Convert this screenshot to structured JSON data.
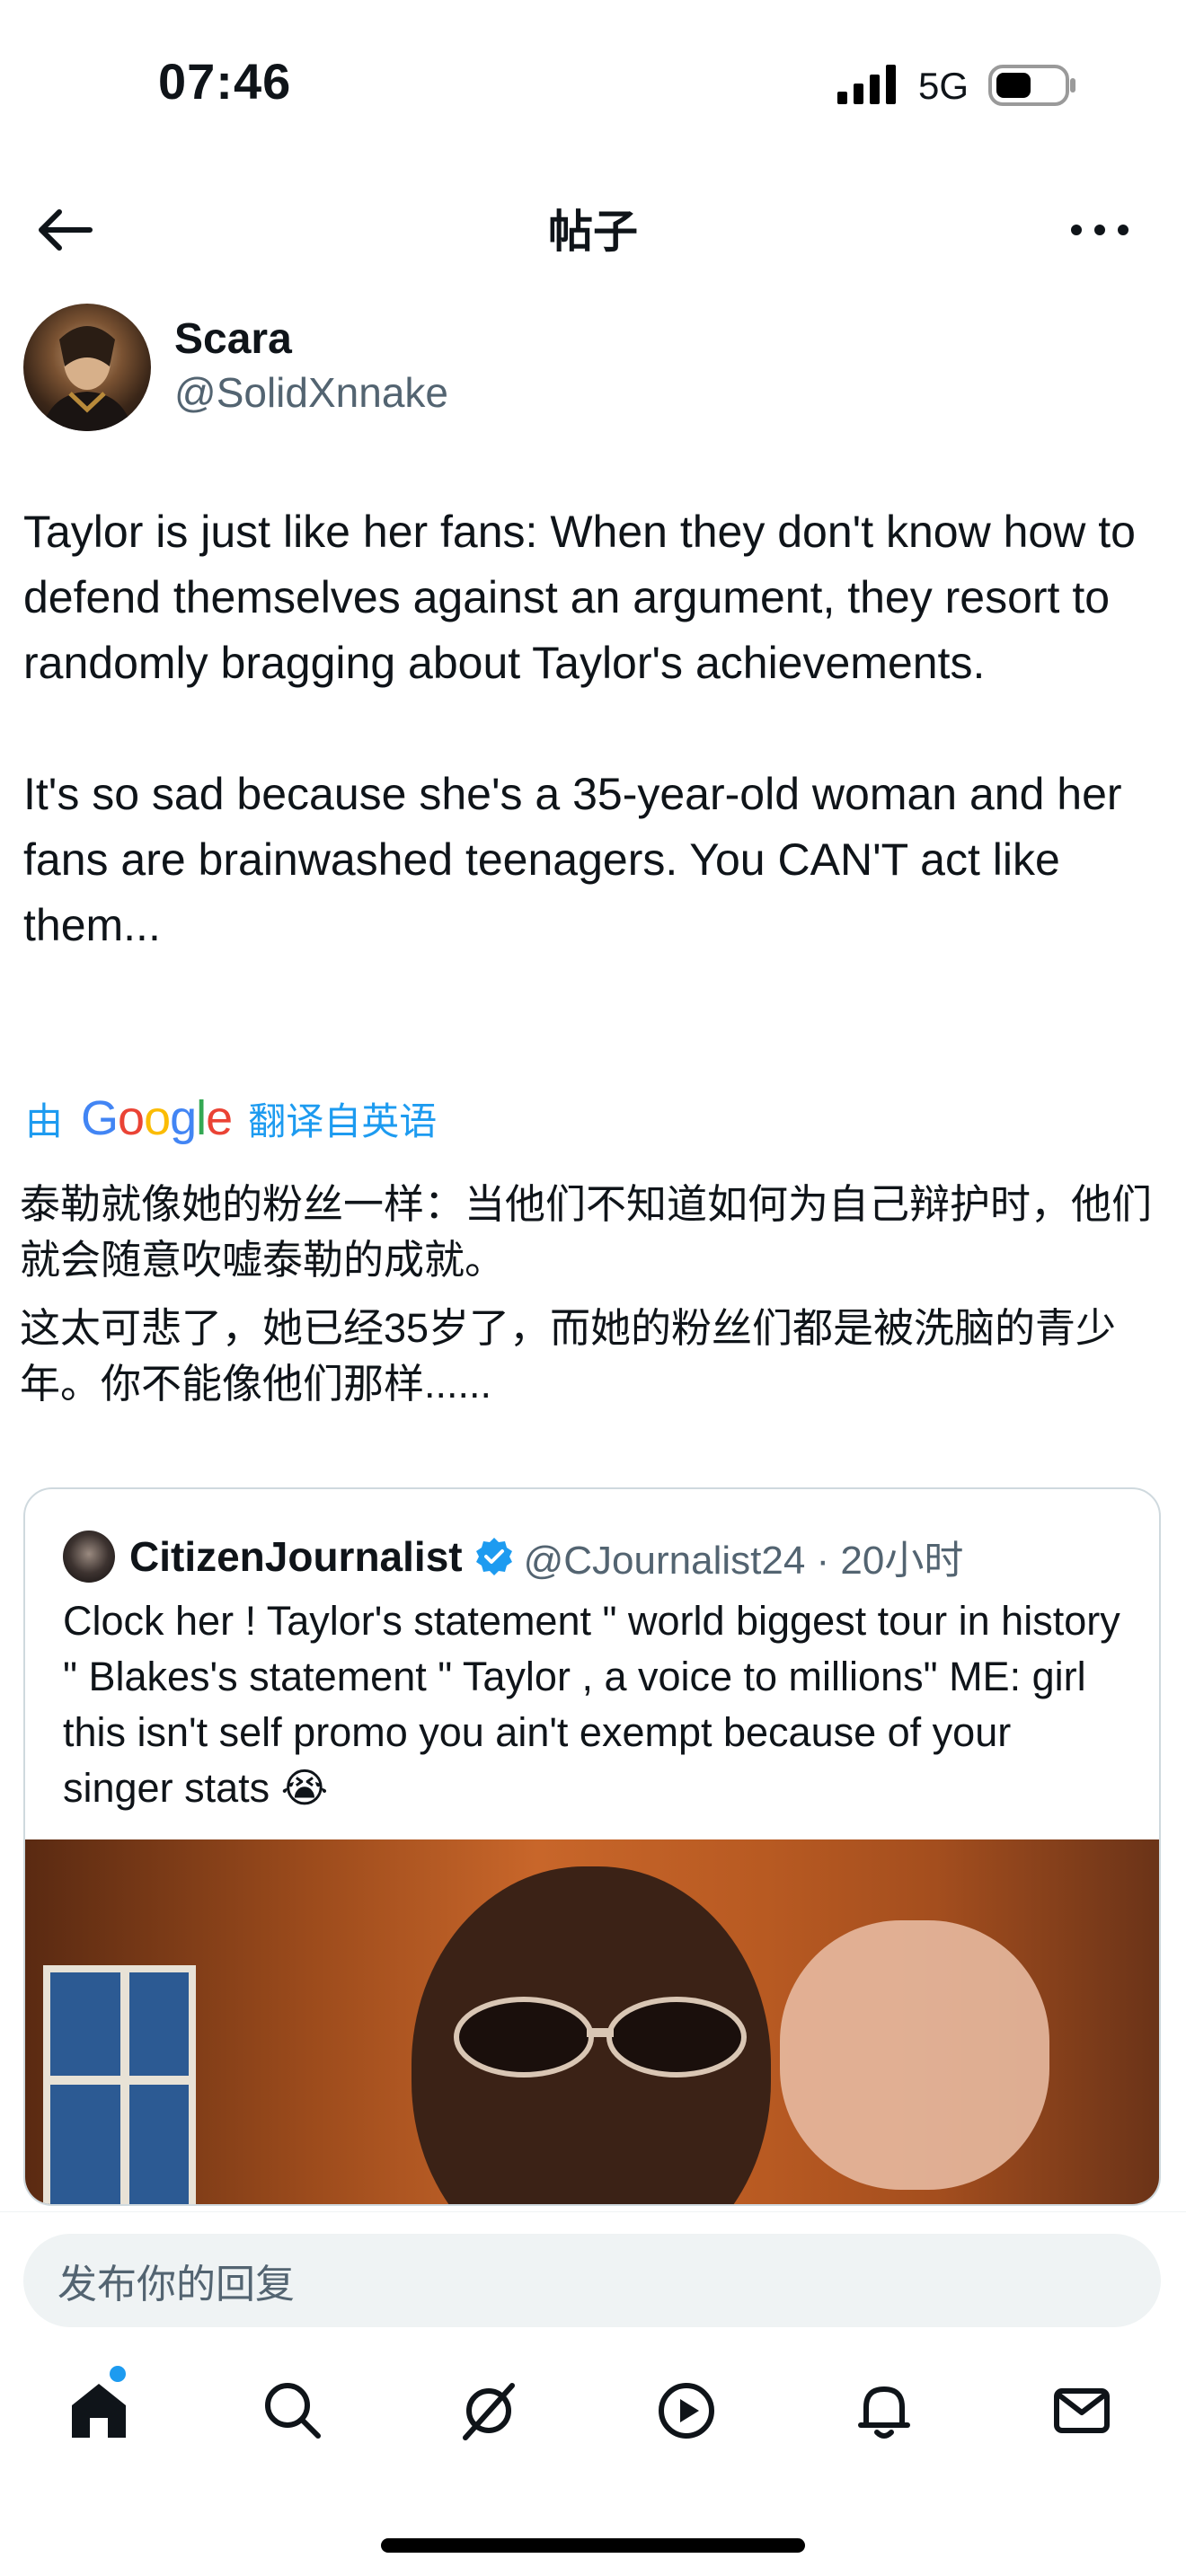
{
  "status_bar": {
    "time": "07:46",
    "network": "5G",
    "signal_icon": "signal-bars-icon",
    "battery_icon": "battery-icon"
  },
  "header": {
    "title": "帖子",
    "back_icon": "back-arrow-icon",
    "more_icon": "more-options-icon"
  },
  "post": {
    "author_name": "Scara",
    "author_handle": "@SolidXnnake",
    "paragraphs": [
      "Taylor is just like her fans: When they don't know how to defend themselves against an argument, they resort to randomly bragging about Taylor's achievements.",
      "It's so sad because she's a 35-year-old woman and her fans are brainwashed teenagers. You CAN'T act like them..."
    ],
    "translate_prefix": "由",
    "translate_brand": "Google",
    "translate_suffix": "翻译自英语",
    "translated_paragraphs": [
      "泰勒就像她的粉丝一样：当他们不知道如何为自己辩护时，他们就会随意吹嘘泰勒的成就。",
      "这太可悲了，她已经35岁了，而她的粉丝们都是被洗脑的青少年。你不能像他们那样......"
    ]
  },
  "quote": {
    "name": "CitizenJournalist",
    "verified_icon": "verified-badge-icon",
    "handle_time": "@CJournalist24 · 20小时",
    "text": "Clock her ! Taylor's  statement \" world biggest tour in history \" Blakes's statement \" Taylor , a voice to millions\" ME: girl this isn't self promo you ain't exempt because of your singer stats 😭"
  },
  "reply": {
    "placeholder": "发布你的回复"
  },
  "nav": {
    "items": [
      "home-icon",
      "search-icon",
      "grok-icon",
      "video-play-icon",
      "notifications-bell-icon",
      "messages-mail-icon"
    ],
    "active": "home-icon",
    "accent_color": "#1d9bf0"
  }
}
